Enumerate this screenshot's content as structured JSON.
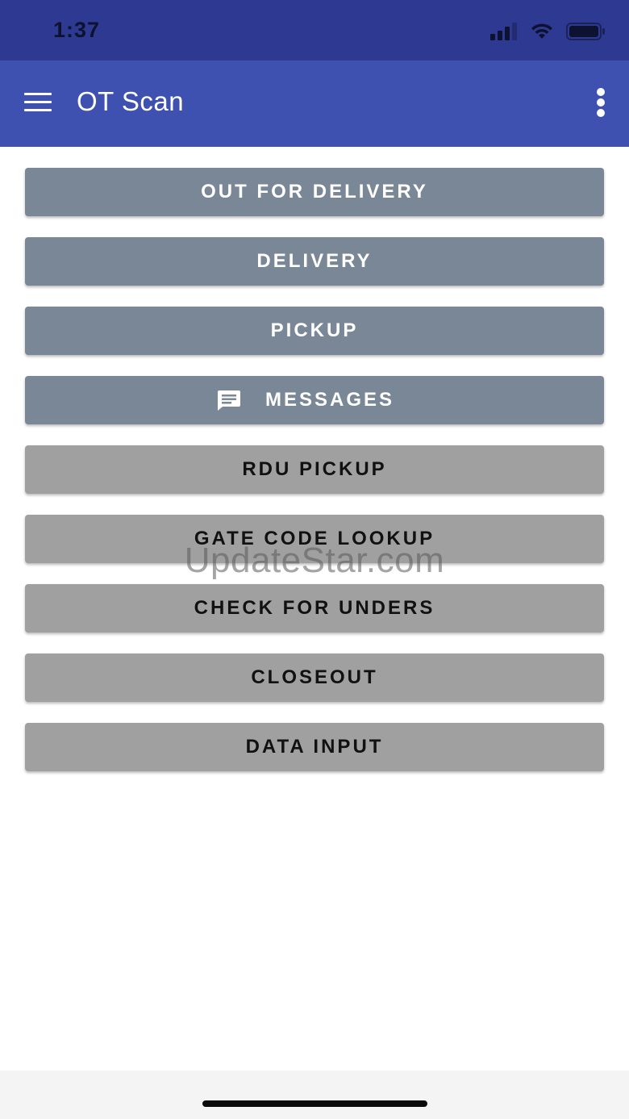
{
  "status_bar": {
    "time": "1:37",
    "icons": [
      "signal-icon",
      "wifi-icon",
      "battery-icon"
    ]
  },
  "app_bar": {
    "title": "OT Scan",
    "left_icon": "menu-icon",
    "right_icon": "overflow-menu-icon"
  },
  "menu": {
    "buttons": [
      {
        "label": "OUT FOR DELIVERY",
        "style": "primary"
      },
      {
        "label": "DELIVERY",
        "style": "primary"
      },
      {
        "label": "PICKUP",
        "style": "primary"
      },
      {
        "label": "MESSAGES",
        "style": "primary",
        "icon": "message-icon"
      },
      {
        "label": "RDU PICKUP",
        "style": "secondary"
      },
      {
        "label": "GATE CODE LOOKUP",
        "style": "secondary"
      },
      {
        "label": "CHECK FOR UNDERS",
        "style": "secondary"
      },
      {
        "label": "CLOSEOUT",
        "style": "secondary"
      },
      {
        "label": "DATA INPUT",
        "style": "secondary"
      }
    ]
  },
  "watermark": "UpdateStar.com",
  "colors": {
    "status_bar": "#2e3a92",
    "app_bar": "#3f51b0",
    "primary_button": "#7a8797",
    "secondary_button": "#a0a0a0"
  }
}
